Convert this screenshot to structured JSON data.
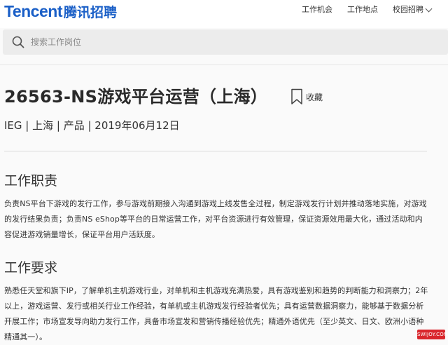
{
  "header": {
    "logo_en": "Tencent",
    "logo_cn": "腾讯招聘",
    "nav": [
      "工作机会",
      "工作地点",
      "校园招聘"
    ]
  },
  "search": {
    "placeholder": "搜索工作岗位"
  },
  "job": {
    "title": "26563-NS游戏平台运营（上海）",
    "favorite_label": "收藏",
    "meta": "IEG | 上海 | 产品 | 2019年06月12日"
  },
  "sections": [
    {
      "title": "工作职责",
      "text": "负责NS平台下游戏的发行工作，参与游戏前期接入沟通到游戏上线发售全过程，制定游戏发行计划并推动落地实施，对游戏的发行结果负责；负责NS eShop等平台的日常运营工作，对平台资源进行有效管理，保证资源效用最大化，通过活动和内容促进游戏销量增长，保证平台用户活跃度。"
    },
    {
      "title": "工作要求",
      "text": "熟悉任天堂和旗下IP，了解单机主机游戏行业，对单机和主机游戏充满热爱，具有游戏鉴别和趋势的判断能力和洞察力；2年以上，游戏运营、发行或相关行业工作经验，有单机或主机游戏发行经验者优先；具有运营数据洞察力，能够基于数据分析开展工作；市场宣发导向助力发行工作，具备市场宣发和营销传播经验优先；精通外语优先（至少英文、日文、欧洲小语种精通其一）。"
    }
  ],
  "watermark": "SWIJOY.COM",
  "colors": {
    "brand": "#1a5fc7",
    "watermark_bg": "#d9262c"
  }
}
